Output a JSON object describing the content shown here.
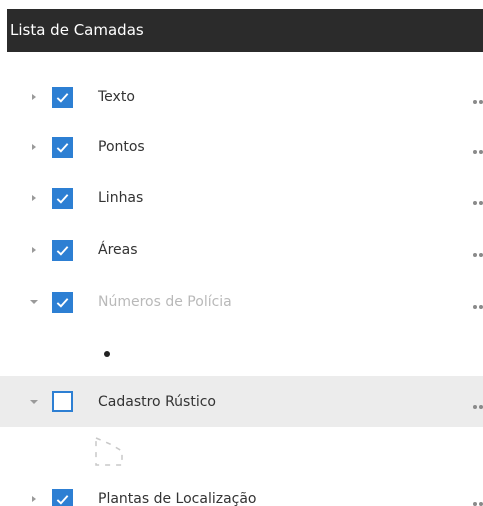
{
  "panel": {
    "title": "Lista de Camadas"
  },
  "layers": [
    {
      "label": "Texto",
      "checked": true,
      "expanded": false,
      "enabled": true
    },
    {
      "label": "Pontos",
      "checked": true,
      "expanded": false,
      "enabled": true
    },
    {
      "label": "Linhas",
      "checked": true,
      "expanded": false,
      "enabled": true
    },
    {
      "label": "Áreas",
      "checked": true,
      "expanded": false,
      "enabled": true
    },
    {
      "label": "Números de Polícia",
      "checked": true,
      "expanded": true,
      "enabled": false,
      "legend_icon": "point-symbol-icon"
    },
    {
      "label": "Cadastro Rústico",
      "checked": false,
      "expanded": true,
      "enabled": true,
      "selected": true,
      "legend_icon": "polygon-dashed-symbol-icon"
    },
    {
      "label": "Plantas de Localização",
      "checked": true,
      "expanded": false,
      "enabled": true
    }
  ],
  "colors": {
    "header_bg": "#2b2b2b",
    "checkbox_accent": "#2d7fd3",
    "selected_row_bg": "#ececec",
    "muted_text": "#b9b9b9"
  }
}
